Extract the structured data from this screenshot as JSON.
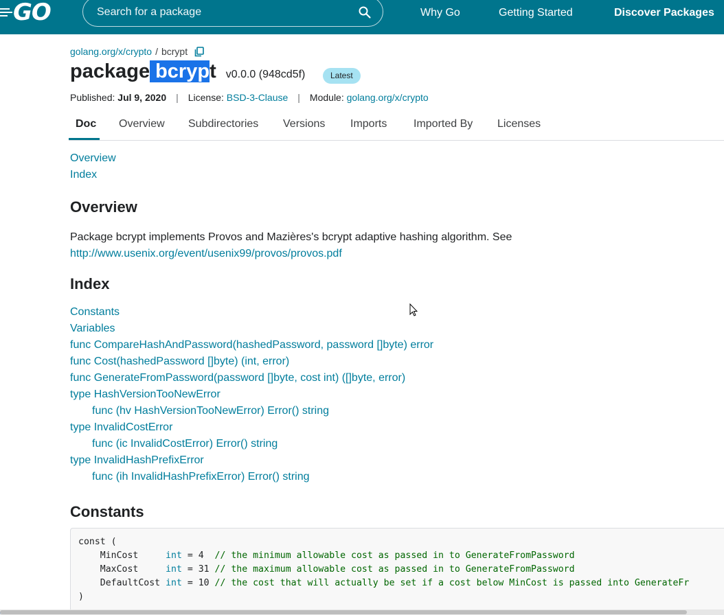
{
  "header": {
    "logo": "GO",
    "search_placeholder": "Search for a package",
    "nav": {
      "why_go": "Why Go",
      "getting_started": "Getting Started",
      "discover_packages": "Discover Packages"
    }
  },
  "breadcrumb": {
    "module_link": "golang.org/x/crypto",
    "separator": "/",
    "current": "bcrypt"
  },
  "title": {
    "keyword": "package",
    "name_selected": "bcryp",
    "name_rest": "t",
    "version": "v0.0.0 (948cd5f)",
    "badge": "Latest"
  },
  "meta": {
    "published_label": "Published:",
    "published_value": "Jul 9, 2020",
    "license_label": "License:",
    "license_value": "BSD-3-Clause",
    "module_label": "Module:",
    "module_value": "golang.org/x/crypto",
    "divider": "|"
  },
  "tabs": [
    "Doc",
    "Overview",
    "Subdirectories",
    "Versions",
    "Imports",
    "Imported By",
    "Licenses"
  ],
  "toc": [
    "Overview",
    "Index"
  ],
  "overview": {
    "heading": "Overview",
    "text": "Package bcrypt implements Provos and Mazières's bcrypt adaptive hashing algorithm. See",
    "link": "http://www.usenix.org/event/usenix99/provos/provos.pdf"
  },
  "index": {
    "heading": "Index",
    "items": [
      "Constants",
      "Variables",
      "func CompareHashAndPassword(hashedPassword, password []byte) error",
      "func Cost(hashedPassword []byte) (int, error)",
      "func GenerateFromPassword(password []byte, cost int) ([]byte, error)",
      "type HashVersionTooNewError",
      "func (hv HashVersionTooNewError) Error() string",
      "type InvalidCostError",
      "func (ic InvalidCostError) Error() string",
      "type InvalidHashPrefixError",
      "func (ih InvalidHashPrefixError) Error() string"
    ]
  },
  "constants": {
    "heading": "Constants",
    "code": {
      "open": "const (",
      "lines": [
        {
          "name": "MinCost    ",
          "type": "int",
          "assign": " = 4  ",
          "comment": "// the minimum allowable cost as passed in to GenerateFromPassword"
        },
        {
          "name": "MaxCost    ",
          "type": "int",
          "assign": " = 31 ",
          "comment": "// the maximum allowable cost as passed in to GenerateFromPassword"
        },
        {
          "name": "DefaultCost",
          "type": "int",
          "assign": " = 10 ",
          "comment": "// the cost that will actually be set if a cost below MinCost is passed into GenerateFr"
        }
      ],
      "close": ")"
    }
  },
  "colors": {
    "header_bg": "#00758d",
    "link": "#007d9c",
    "badge_bg": "#a6e2f2",
    "selection": "#1a73e8"
  }
}
